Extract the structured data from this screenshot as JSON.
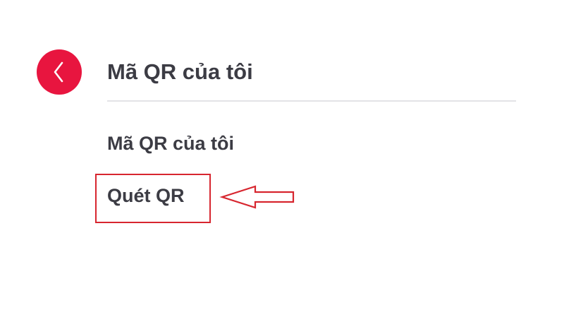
{
  "header": {
    "title": "Mã QR của tôi"
  },
  "back_button": {
    "icon": "chevron-left-icon"
  },
  "menu": {
    "items": [
      {
        "label": "Mã QR của tôi"
      },
      {
        "label": "Quét QR"
      }
    ]
  },
  "annotation": {
    "highlighted_item": "Quét QR"
  },
  "colors": {
    "accent": "#e8153f",
    "annotation": "#d7262f",
    "text": "#3c3c44",
    "divider": "#e3e3e6",
    "background": "#ffffff"
  }
}
